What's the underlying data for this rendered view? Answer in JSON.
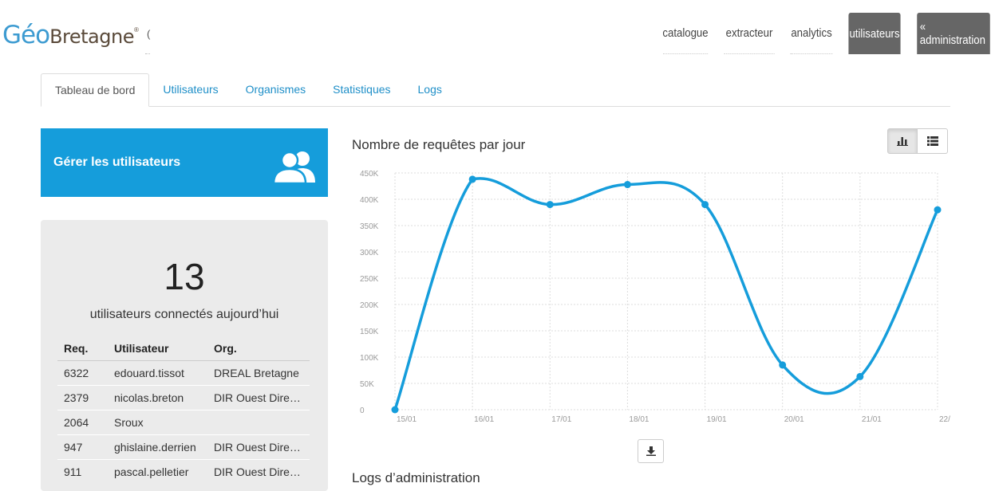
{
  "header": {
    "logo_geo": "Géo",
    "logo_bretagne": "Bretagne",
    "logo_reg": "®",
    "truncated_text": "(",
    "nav": [
      {
        "label": "catalogue"
      },
      {
        "label": "extracteur"
      },
      {
        "label": "analytics"
      },
      {
        "label": "utilisateurs"
      },
      {
        "label": "« administration"
      }
    ]
  },
  "tabs": [
    {
      "label": "Tableau de bord",
      "active": true
    },
    {
      "label": "Utilisateurs"
    },
    {
      "label": "Organismes"
    },
    {
      "label": "Statistiques"
    },
    {
      "label": "Logs"
    }
  ],
  "manage_card": {
    "label": "Gérer les utilisateurs",
    "icon": "users-icon",
    "color": "#159ddb"
  },
  "stats": {
    "count": "13",
    "caption": "utilisateurs connectés aujourd’hui",
    "columns": [
      "Req.",
      "Utilisateur",
      "Org."
    ],
    "rows": [
      {
        "req": "6322",
        "user": "edouard.tissot",
        "org": "DREAL Bretagne"
      },
      {
        "req": "2379",
        "user": "nicolas.breton",
        "org": "DIR Ouest Direction Interdépartementale des Routes"
      },
      {
        "req": "2064",
        "user": "Sroux",
        "org": ""
      },
      {
        "req": "947",
        "user": "ghislaine.derrien",
        "org": "DIR Ouest Direction Interdépartementale des Routes"
      },
      {
        "req": "911",
        "user": "pascal.pelletier",
        "org": "DIR Ouest Direction Interdépartementale des Routes"
      }
    ]
  },
  "chart_section": {
    "title": "Nombre de requêtes par jour",
    "view_buttons": [
      "bar-chart-icon",
      "list-icon"
    ],
    "download_icon": "download-icon",
    "logs_heading": "Logs d’administration"
  },
  "chart_data": {
    "type": "line",
    "categories": [
      "15/01",
      "16/01",
      "17/01",
      "18/01",
      "19/01",
      "20/01",
      "21/01",
      "22/"
    ],
    "values": [
      0,
      438000,
      390000,
      428000,
      390000,
      85000,
      63000,
      380000
    ],
    "ylim": [
      0,
      450000
    ],
    "yticks": [
      "0",
      "50K",
      "100K",
      "150K",
      "200K",
      "250K",
      "300K",
      "350K",
      "400K",
      "450K"
    ],
    "grid": true,
    "color": "#159ddb"
  }
}
